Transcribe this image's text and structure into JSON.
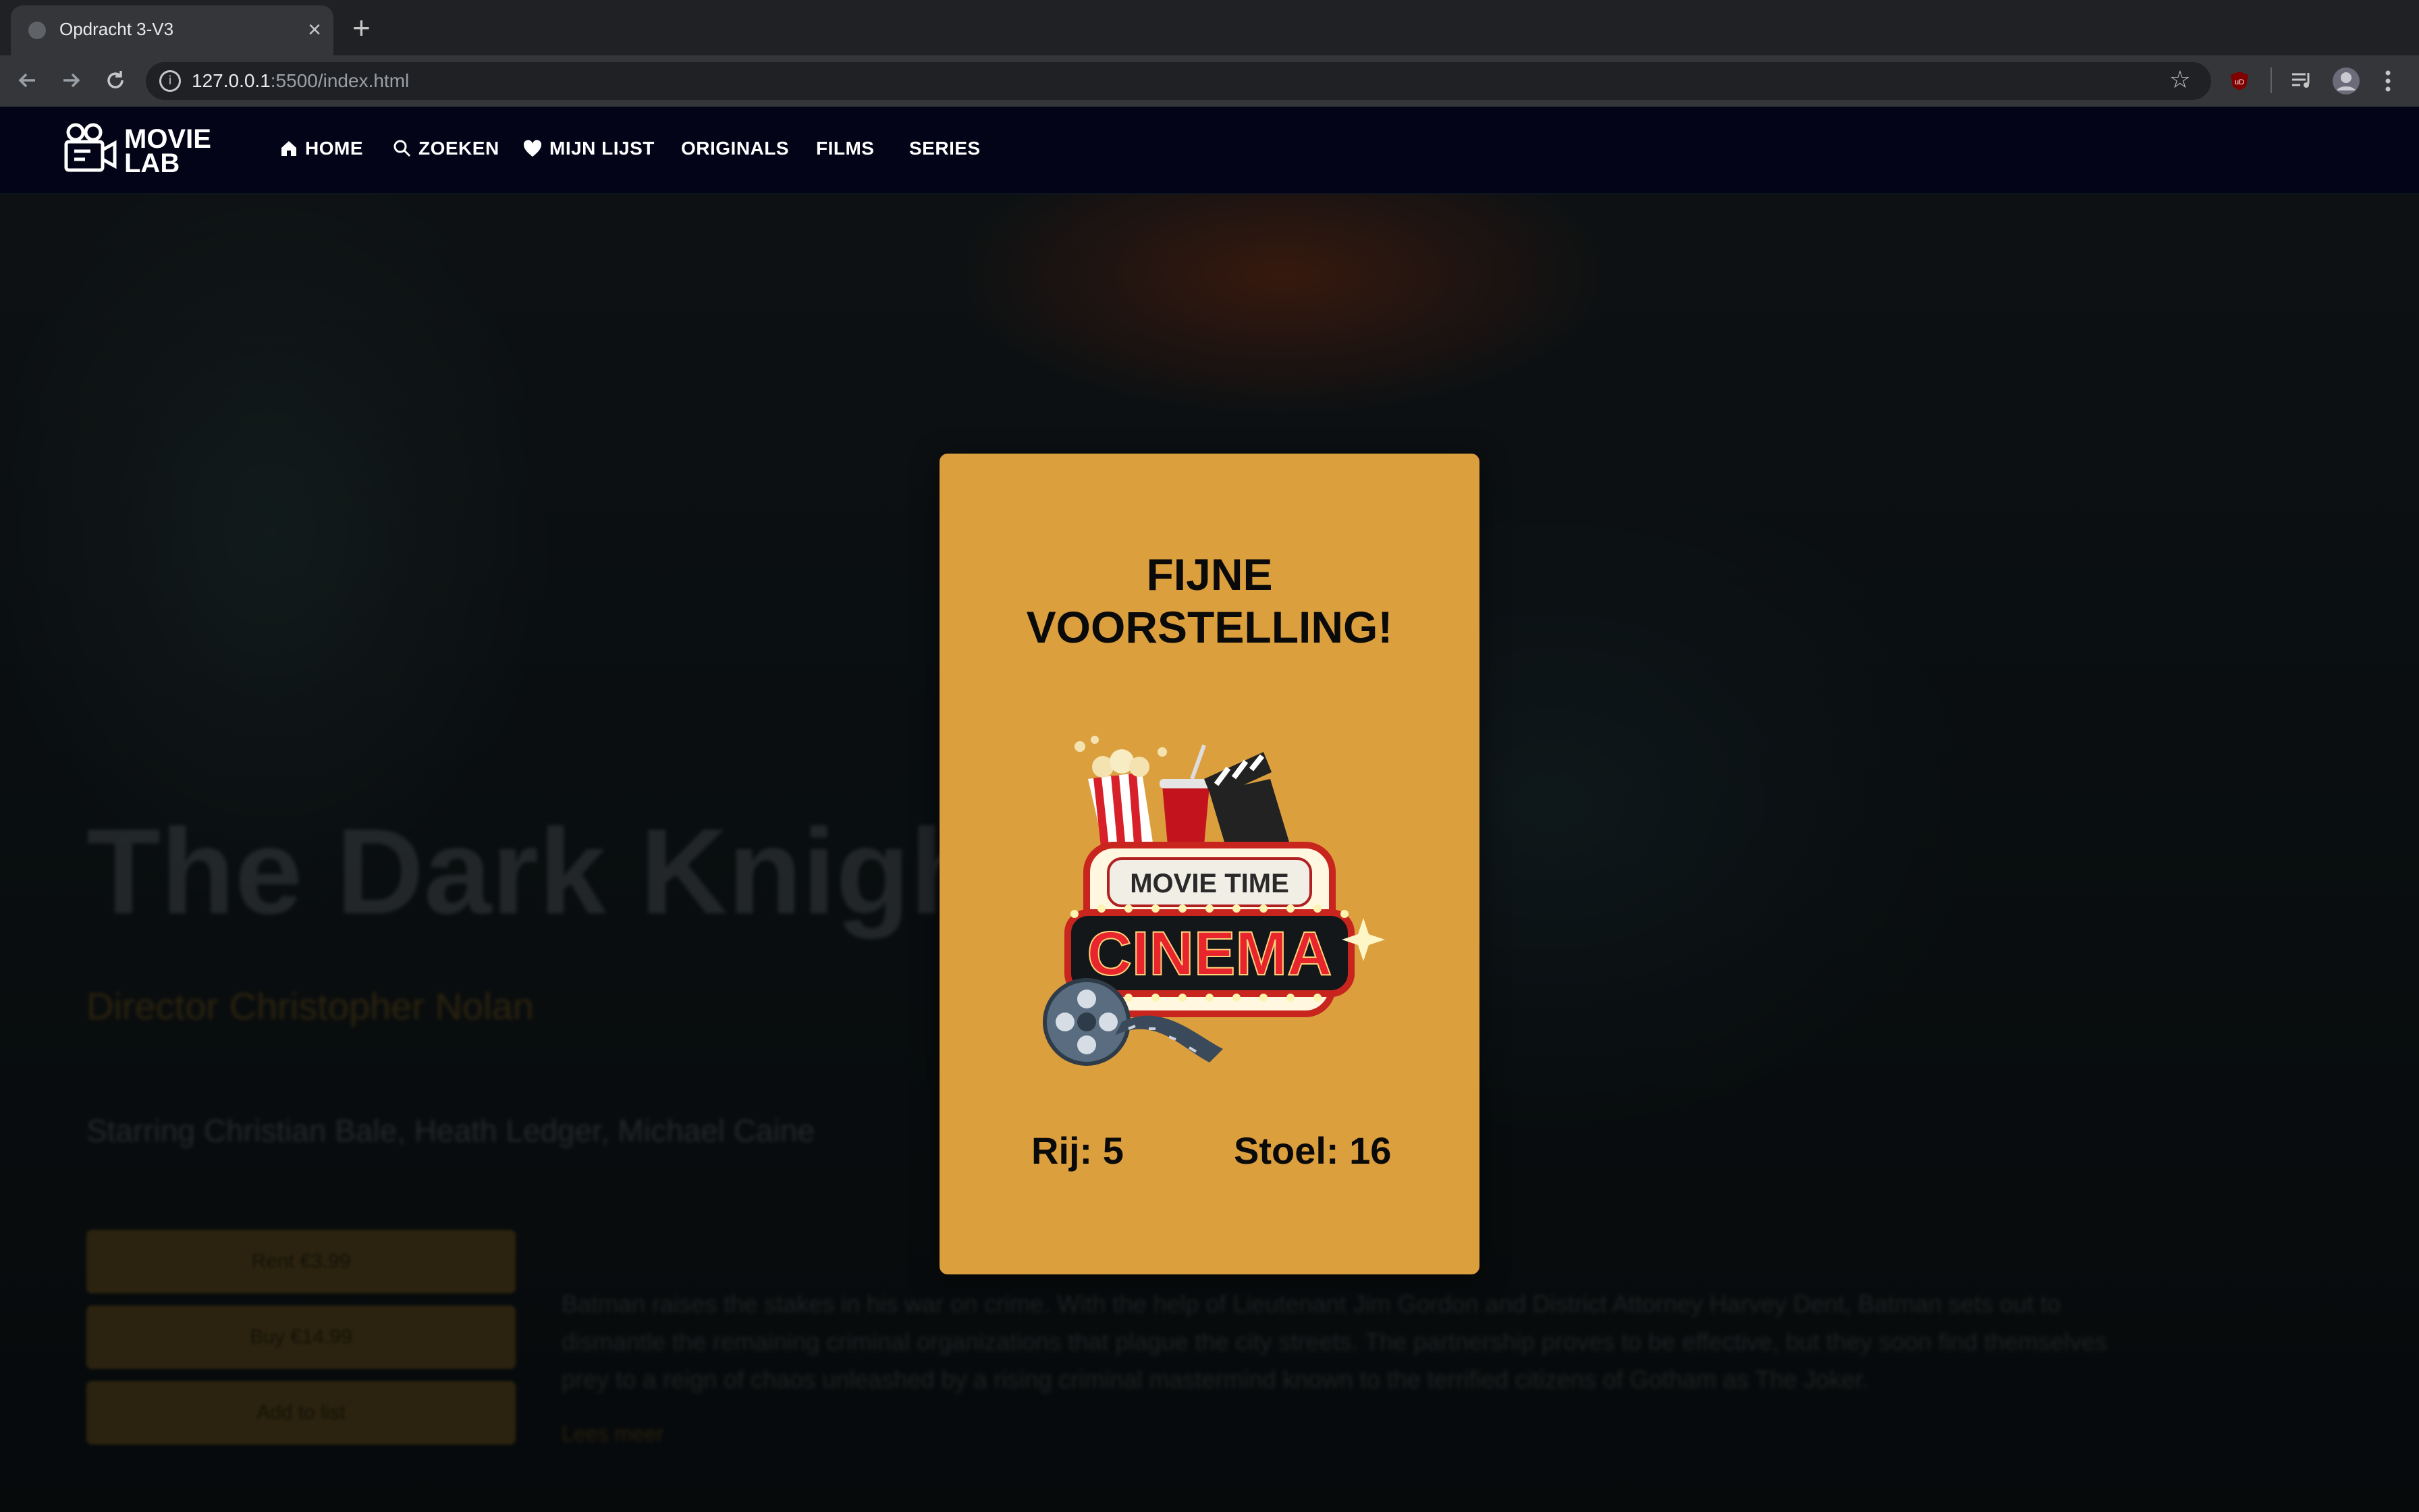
{
  "browser": {
    "tab_title": "Opdracht 3-V3",
    "url_host": "127.0.0.1",
    "url_rest": ":5500/index.html",
    "ext_badge": "uD"
  },
  "site": {
    "logo_line1": "MOVIE",
    "logo_line2": "LAB",
    "nav": [
      {
        "label": "HOME",
        "icon": "home-icon"
      },
      {
        "label": "ZOEKEN",
        "icon": "search-icon"
      },
      {
        "label": "MIJN LIJST",
        "icon": "heart-icon"
      },
      {
        "label": "ORIGINALS"
      },
      {
        "label": "FILMS"
      },
      {
        "label": "SERIES"
      }
    ]
  },
  "hero": {
    "title": "The Dark Knight",
    "director": "Director Christopher Nolan",
    "starring": "Starring Christian Bale, Heath Ledger, Michael Caine",
    "buttons": [
      "Rent €3.99",
      "Buy €14.99",
      "Add to list"
    ],
    "description": "Batman raises the stakes in his war on crime. With the help of Lieutenant Jim Gordon and District Attorney Harvey Dent, Batman sets out to dismantle the remaining criminal organizations that plague the city streets. The partnership proves to be effective, but they soon find themselves prey to a reign of chaos unleashed by a rising criminal mastermind known to the terrified citizens of Gotham as The Joker.",
    "more": "Lees meer"
  },
  "modal": {
    "title": "FIJNE\nVOORSTELLING!",
    "image_text_top": "MOVIE TIME",
    "image_text_main": "CINEMA",
    "row": "Rij: 5",
    "seat": "Stoel: 16"
  },
  "colors": {
    "modal_bg": "#dc9f3e",
    "nav_bg": "#030417",
    "accent": "#e0a035"
  }
}
